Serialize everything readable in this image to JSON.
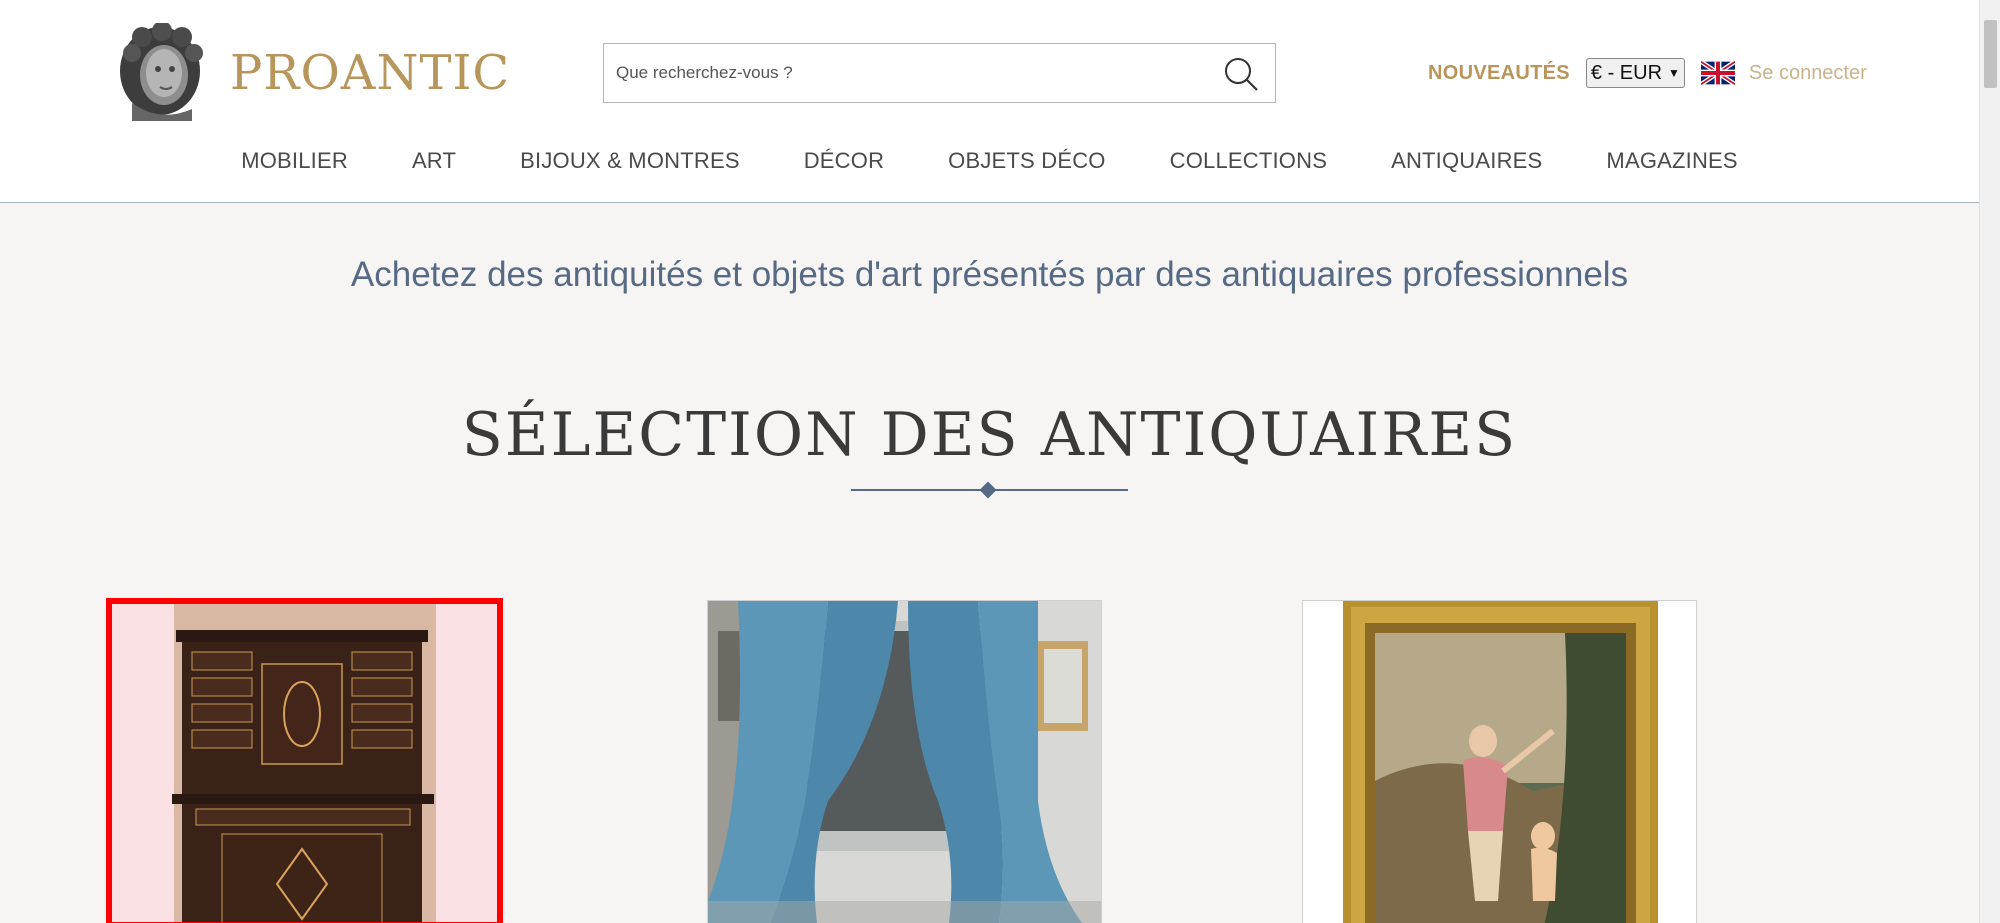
{
  "brand": {
    "name": "PROANTIC",
    "logo_icon": "bust-icon"
  },
  "search": {
    "placeholder": "Que recherchez-vous ?",
    "icon": "search-icon"
  },
  "top_links": {
    "nouveautes": "NOUVEAUTÉS",
    "currency": "€ - EUR",
    "language_flag": "uk-flag-icon",
    "login": "Se connecter"
  },
  "nav": {
    "items": [
      {
        "label": "MOBILIER"
      },
      {
        "label": "ART"
      },
      {
        "label": "BIJOUX & MONTRES"
      },
      {
        "label": "DÉCOR"
      },
      {
        "label": "OBJETS DÉCO"
      },
      {
        "label": "COLLECTIONS"
      },
      {
        "label": "ANTIQUAIRES"
      },
      {
        "label": "MAGAZINES"
      }
    ]
  },
  "main": {
    "tagline": "Achetez des antiquités et objets d'art présentés par des antiquaires professionnels",
    "section_title": "SÉLECTION DES ANTIQUAIRES"
  },
  "colors": {
    "brand_gold": "#b8955a",
    "accent_blue": "#566a85",
    "highlight_red": "#ff0000"
  }
}
